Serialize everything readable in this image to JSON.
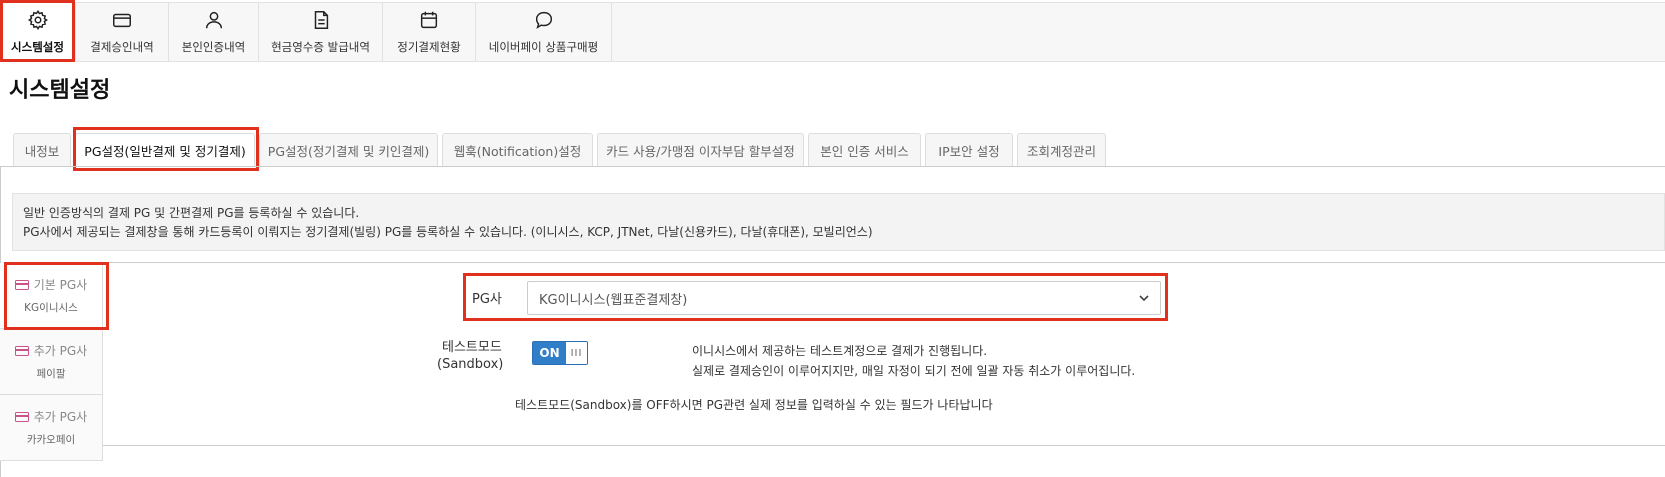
{
  "topnav": {
    "items": [
      {
        "label": "시스템설정",
        "icon": "gear-icon"
      },
      {
        "label": "결제승인내역",
        "icon": "credit-card-icon"
      },
      {
        "label": "본인인증내역",
        "icon": "user-icon"
      },
      {
        "label": "현금영수증 발급내역",
        "icon": "document-icon"
      },
      {
        "label": "정기결제현황",
        "icon": "calendar-icon"
      },
      {
        "label": "네이버페이 상품구매평",
        "icon": "speech-bubble-icon"
      }
    ]
  },
  "page_title": "시스템설정",
  "tabs": [
    {
      "label": "내정보"
    },
    {
      "label": "PG설정(일반결제 및 정기결제)"
    },
    {
      "label": "PG설정(정기결제 및 키인결제)"
    },
    {
      "label": "웹훅(Notification)설정"
    },
    {
      "label": "카드 사용/가맹점 이자부담 할부설정"
    },
    {
      "label": "본인 인증 서비스"
    },
    {
      "label": "IP보안 설정"
    },
    {
      "label": "조회계정관리"
    }
  ],
  "info": {
    "line1": "일반 인증방식의 결제 PG 및 간편결제 PG를 등록하실 수 있습니다.",
    "line2": "PG사에서 제공되는 결제창을 통해 카드등록이 이뤄지는 정기결제(빌링) PG를 등록하실 수 있습니다. (이니시스, KCP, JTNet, 다날(신용카드), 다날(휴대폰), 모빌리언스)"
  },
  "side": {
    "items": [
      {
        "title": "기본 PG사",
        "sub": "KG이니시스"
      },
      {
        "title": "추가 PG사",
        "sub": "페이팔"
      },
      {
        "title": "추가 PG사",
        "sub": "카카오페이"
      }
    ]
  },
  "form": {
    "pg_label": "PG사",
    "pg_value": "KG이니시스(웹표준결제창)",
    "test_label_1": "테스트모드",
    "test_label_2": "(Sandbox)",
    "toggle_on": "ON",
    "toggle_knob": "III",
    "desc_1": "이니시스에서 제공하는 테스트계정으로 결제가 진행됩니다.",
    "desc_2": "실제로 결제승인이 이루어지지만, 매일 자정이 되기 전에 일괄 자동 취소가 이루어집니다.",
    "note": "테스트모드(Sandbox)를 OFF하시면 PG관련 실제 정보를 입력하실 수 있는 필드가 나타납니다"
  },
  "colors": {
    "highlight": "#e0301e",
    "toggle": "#2f7ec7",
    "card_icon": "#c9548a"
  }
}
